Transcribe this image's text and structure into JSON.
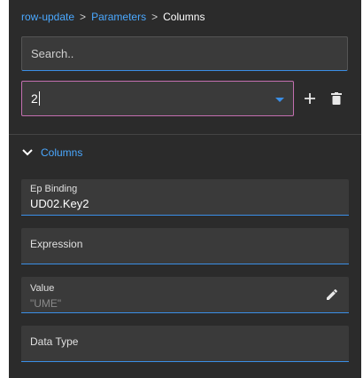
{
  "breadcrumb": {
    "items": [
      "row-update",
      "Parameters"
    ],
    "separator": ">",
    "current": "Columns"
  },
  "search": {
    "placeholder": "Search.."
  },
  "selector": {
    "value": "2"
  },
  "section": {
    "title": "Columns"
  },
  "fields": {
    "ep_binding": {
      "label": "Ep Binding",
      "value": "UD02.Key2"
    },
    "expression": {
      "label": "Expression"
    },
    "value": {
      "label": "Value",
      "placeholder": "\"UME\""
    },
    "data_type": {
      "label": "Data Type"
    }
  },
  "colors": {
    "panel_bg": "#2b2b2b",
    "input_bg": "#3a3a3a",
    "accent_blue": "#4aa8ff",
    "focus_border": "#c36fb0"
  }
}
